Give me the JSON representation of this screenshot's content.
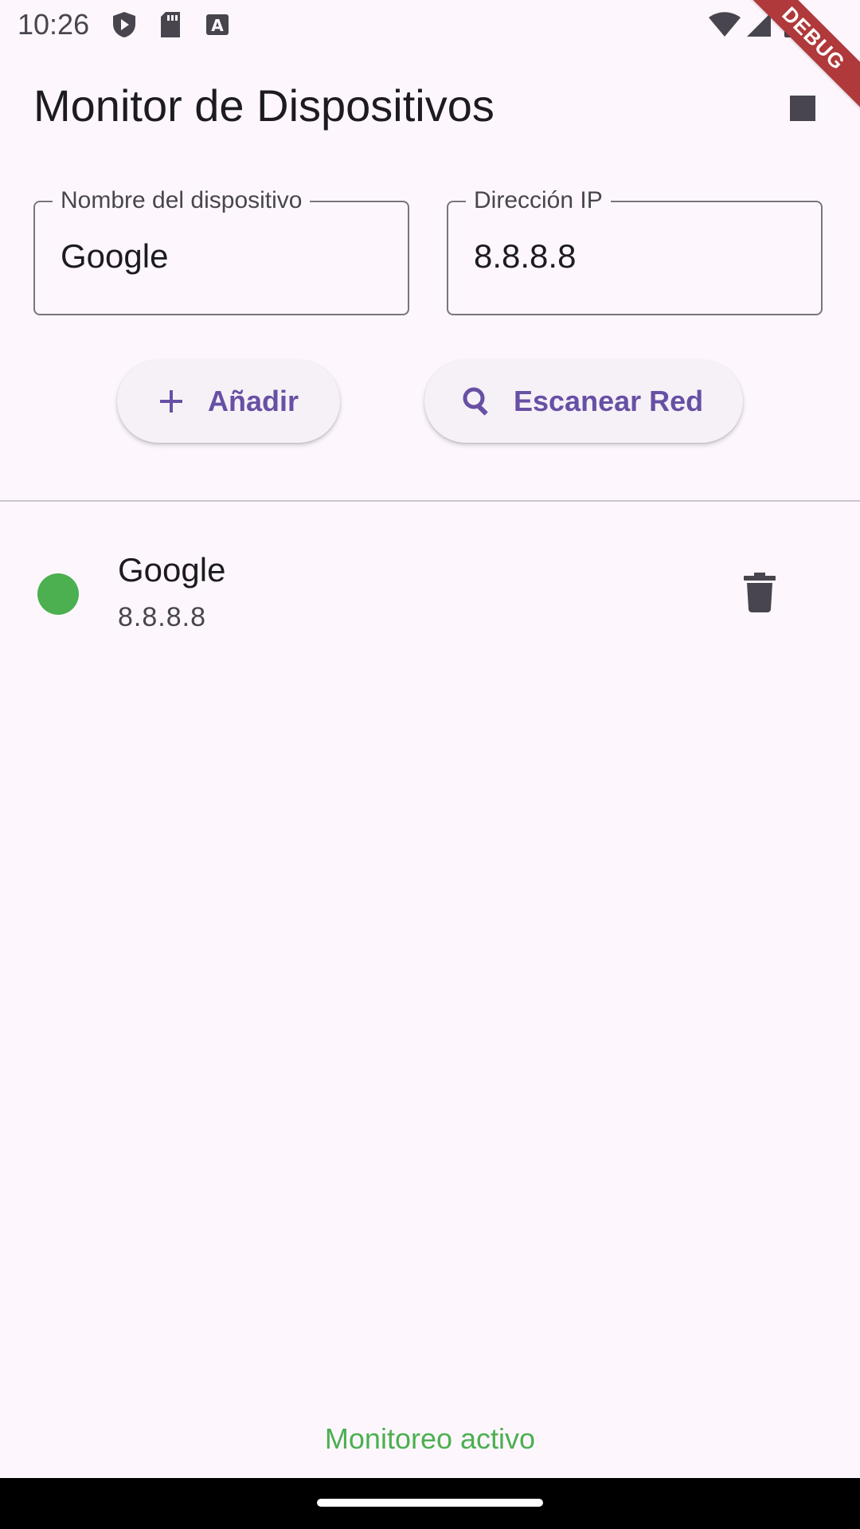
{
  "status_bar": {
    "time": "10:26",
    "icons": [
      "play-protect-icon",
      "sd-card-icon",
      "keyboard-a-icon",
      "wifi-icon",
      "signal-icon",
      "battery-icon"
    ]
  },
  "debug_ribbon": "DEBUG",
  "app_bar": {
    "title": "Monitor de Dispositivos",
    "action_icon": "stop-icon"
  },
  "form": {
    "name_field": {
      "label": "Nombre del dispositivo",
      "value": "Google"
    },
    "ip_field": {
      "label": "Dirección IP",
      "value": "8.8.8.8"
    }
  },
  "buttons": {
    "add_label": "Añadir",
    "scan_label": "Escanear Red"
  },
  "devices": [
    {
      "name": "Google",
      "ip": "8.8.8.8",
      "status_color": "#4caf50"
    }
  ],
  "monitor_status": "Monitoreo activo",
  "colors": {
    "accent": "#6750a4",
    "online": "#4caf50",
    "background": "#fdf7fd"
  }
}
